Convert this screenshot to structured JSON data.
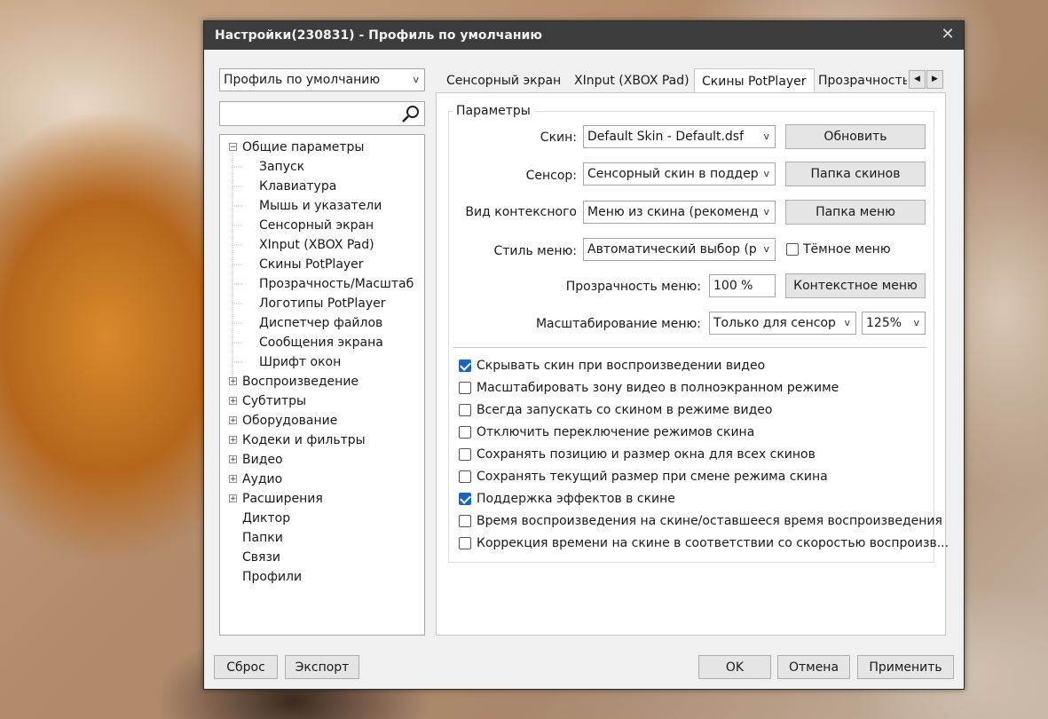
{
  "window": {
    "title": "Настройки(230831) - Профиль по умолчанию"
  },
  "profile": {
    "selected": "Профиль по умолчанию"
  },
  "search": {
    "value": ""
  },
  "tree": {
    "general": "Общие параметры",
    "children": [
      "Запуск",
      "Клавиатура",
      "Мышь и указатели",
      "Сенсорный экран",
      "XInput (XBOX Pad)",
      "Скины PotPlayer",
      "Прозрачность/Масштаб",
      "Логотипы PotPlayer",
      "Диспетчер файлов",
      "Сообщения экрана",
      "Шрифт окон"
    ],
    "groups": [
      "Воспроизведение",
      "Субтитры",
      "Оборудование",
      "Кодеки и фильтры",
      "Видео",
      "Аудио",
      "Расширения"
    ],
    "leaves": [
      "Диктор",
      "Папки",
      "Связи",
      "Профили"
    ]
  },
  "tabs": [
    "Сенсорный экран",
    "XInput (XBOX Pad)",
    "Скины PotPlayer",
    "Прозрачность"
  ],
  "group_title": "Параметры",
  "fields": {
    "skin_label": "Скин:",
    "skin_value": "Default Skin - Default.dsf",
    "refresh": "Обновить",
    "sensor_label": "Сенсор:",
    "sensor_value": "Сенсорный скин в поддер",
    "skins_folder": "Папка скинов",
    "context_label": "Вид контексного",
    "context_value": "Меню из скина (рекоменд",
    "menu_folder": "Папка меню",
    "style_label": "Стиль меню:",
    "style_value": "Автоматический выбор (р",
    "dark_menu": "Тёмное меню",
    "opacity_label": "Прозрачность меню:",
    "opacity_value": "100 %",
    "context_menu": "Контекстное меню",
    "scale_label": "Масштабирование меню:",
    "scale_value": "Только для сенсор",
    "scale_pct": "125%"
  },
  "checkboxes": [
    {
      "label": "Скрывать скин при воспроизведении видео",
      "checked": true
    },
    {
      "label": "Масштабировать зону видео в полноэкранном режиме",
      "checked": false
    },
    {
      "label": "Всегда запускать со скином в режиме видео",
      "checked": false
    },
    {
      "label": "Отключить переключение режимов скина",
      "checked": false
    },
    {
      "label": "Сохранять позицию и размер окна для всех скинов",
      "checked": false
    },
    {
      "label": "Сохранять текущий размер при смене режима скина",
      "checked": false
    },
    {
      "label": "Поддержка эффектов в скине",
      "checked": true
    },
    {
      "label": "Время воспроизведения на скине/оставшееся время воспроизведения",
      "checked": false
    },
    {
      "label": "Коррекция времени на скине в соответствии со скоростью воспроизв...",
      "checked": false
    }
  ],
  "footer": {
    "reset": "Сброс",
    "export": "Экспорт",
    "ok": "OK",
    "cancel": "Отмена",
    "apply": "Применить"
  }
}
